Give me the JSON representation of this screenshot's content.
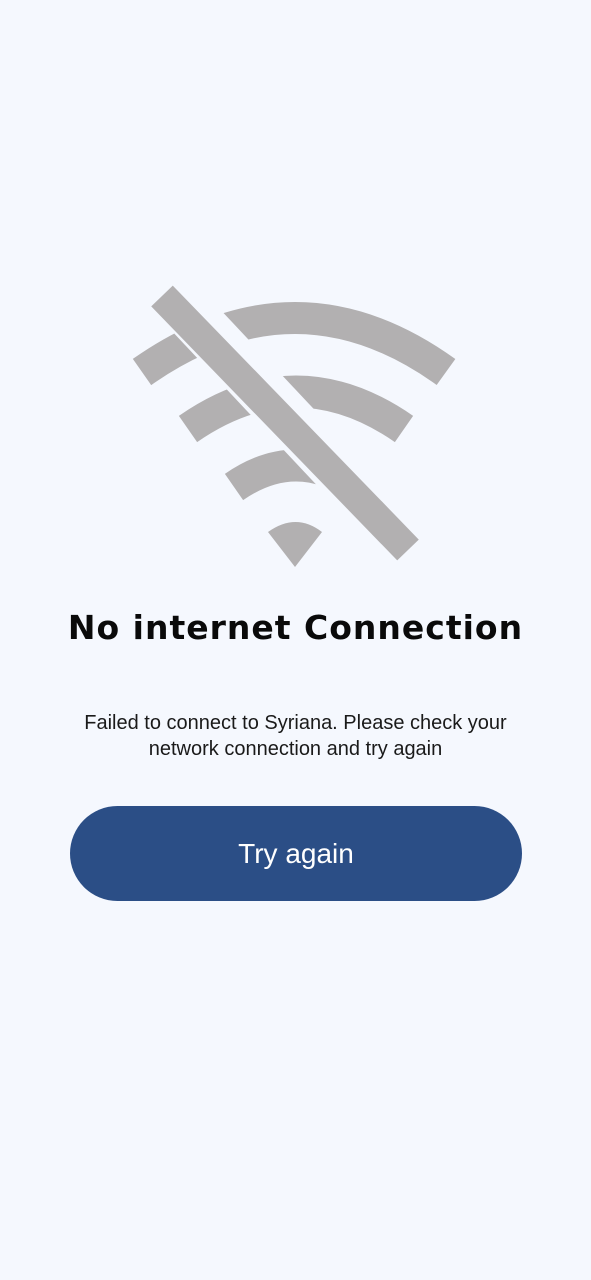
{
  "status_icon": "wifi-off-icon",
  "title": "No internet Connection",
  "message": "Failed to connect to Syriana. Please check your network connection and try again",
  "retry_button_label": "Try again",
  "colors": {
    "background": "#f5f8fe",
    "icon": "#b2b0b1",
    "button": "#2b4e86",
    "button_text": "#ffffff",
    "title": "#0a0a0a"
  }
}
